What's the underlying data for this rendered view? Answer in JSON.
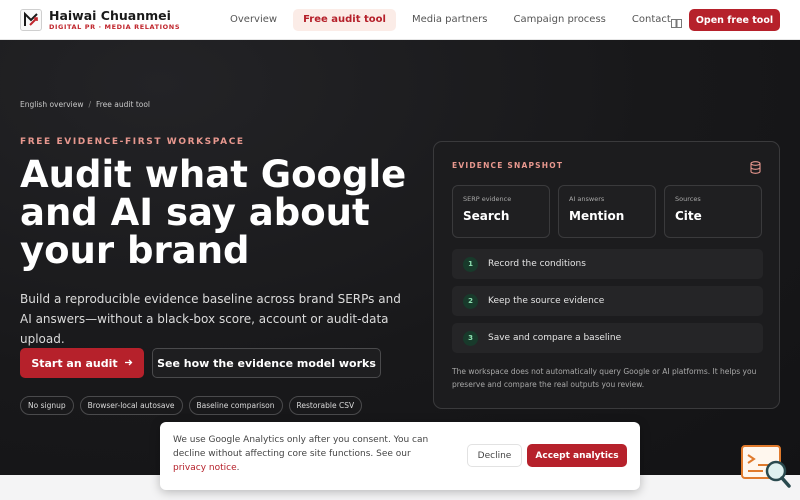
{
  "header": {
    "brand_name": "Haiwai Chuanmei",
    "brand_tagline": "DIGITAL PR · MEDIA RELATIONS",
    "nav": [
      {
        "label": "Overview",
        "active": false
      },
      {
        "label": "Free audit tool",
        "active": true
      },
      {
        "label": "Media partners",
        "active": false
      },
      {
        "label": "Campaign process",
        "active": false
      },
      {
        "label": "Contact",
        "active": false
      }
    ],
    "language_icon": "translate-icon",
    "cta_label": "Open free tool"
  },
  "breadcrumb": {
    "items": [
      "English overview",
      "Free audit tool"
    ],
    "separator": "/"
  },
  "hero": {
    "eyebrow": "FREE EVIDENCE-FIRST WORKSPACE",
    "headline": "Audit what Google and AI say about your brand",
    "lede": "Build a reproducible evidence baseline across brand SERPs and AI answers—without a black-box score, account or audit-data upload.",
    "primary_button": "Start an audit",
    "primary_button_icon": "arrow-right-icon",
    "secondary_button": "See how the evidence model works",
    "pills": [
      "No signup",
      "Browser-local autosave",
      "Baseline comparison",
      "Restorable CSV"
    ]
  },
  "snapshot": {
    "title": "EVIDENCE SNAPSHOT",
    "icon": "database-icon",
    "tiles": [
      {
        "label": "SERP evidence",
        "value": "Search"
      },
      {
        "label": "AI answers",
        "value": "Mention"
      },
      {
        "label": "Sources",
        "value": "Cite"
      }
    ],
    "steps": [
      {
        "num": "1",
        "text": "Record the conditions"
      },
      {
        "num": "2",
        "text": "Keep the source evidence"
      },
      {
        "num": "3",
        "text": "Save and compare a baseline"
      }
    ],
    "note": "The workspace does not automatically query Google or AI platforms. It helps you preserve and compare the real outputs you review."
  },
  "cookie": {
    "text_before": "We use Google Analytics only after you consent. You can decline without affecting core site functions. See our ",
    "link": "privacy notice",
    "text_after": ".",
    "decline": "Decline",
    "accept": "Accept analytics"
  },
  "widget": {
    "icon": "search-analytics-icon"
  },
  "colors": {
    "accent": "#b6212b",
    "accent_soft": "#e8988f",
    "hero_bg": "#18181a",
    "step_badge": "#8ee0b1"
  }
}
